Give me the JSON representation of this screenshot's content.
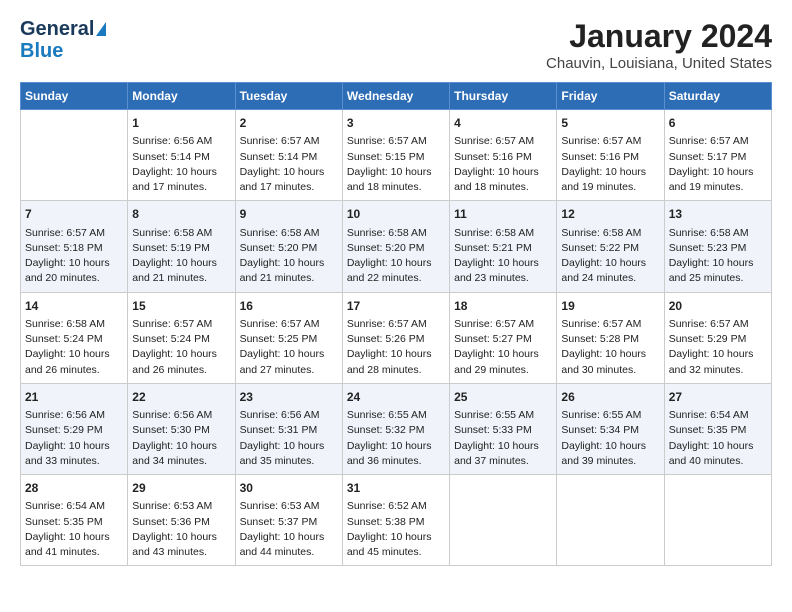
{
  "logo": {
    "line1": "General",
    "line2": "Blue"
  },
  "title": "January 2024",
  "subtitle": "Chauvin, Louisiana, United States",
  "days_of_week": [
    "Sunday",
    "Monday",
    "Tuesday",
    "Wednesday",
    "Thursday",
    "Friday",
    "Saturday"
  ],
  "weeks": [
    [
      {
        "num": "",
        "text": ""
      },
      {
        "num": "1",
        "text": "Sunrise: 6:56 AM\nSunset: 5:14 PM\nDaylight: 10 hours\nand 17 minutes."
      },
      {
        "num": "2",
        "text": "Sunrise: 6:57 AM\nSunset: 5:14 PM\nDaylight: 10 hours\nand 17 minutes."
      },
      {
        "num": "3",
        "text": "Sunrise: 6:57 AM\nSunset: 5:15 PM\nDaylight: 10 hours\nand 18 minutes."
      },
      {
        "num": "4",
        "text": "Sunrise: 6:57 AM\nSunset: 5:16 PM\nDaylight: 10 hours\nand 18 minutes."
      },
      {
        "num": "5",
        "text": "Sunrise: 6:57 AM\nSunset: 5:16 PM\nDaylight: 10 hours\nand 19 minutes."
      },
      {
        "num": "6",
        "text": "Sunrise: 6:57 AM\nSunset: 5:17 PM\nDaylight: 10 hours\nand 19 minutes."
      }
    ],
    [
      {
        "num": "7",
        "text": "Sunrise: 6:57 AM\nSunset: 5:18 PM\nDaylight: 10 hours\nand 20 minutes."
      },
      {
        "num": "8",
        "text": "Sunrise: 6:58 AM\nSunset: 5:19 PM\nDaylight: 10 hours\nand 21 minutes."
      },
      {
        "num": "9",
        "text": "Sunrise: 6:58 AM\nSunset: 5:20 PM\nDaylight: 10 hours\nand 21 minutes."
      },
      {
        "num": "10",
        "text": "Sunrise: 6:58 AM\nSunset: 5:20 PM\nDaylight: 10 hours\nand 22 minutes."
      },
      {
        "num": "11",
        "text": "Sunrise: 6:58 AM\nSunset: 5:21 PM\nDaylight: 10 hours\nand 23 minutes."
      },
      {
        "num": "12",
        "text": "Sunrise: 6:58 AM\nSunset: 5:22 PM\nDaylight: 10 hours\nand 24 minutes."
      },
      {
        "num": "13",
        "text": "Sunrise: 6:58 AM\nSunset: 5:23 PM\nDaylight: 10 hours\nand 25 minutes."
      }
    ],
    [
      {
        "num": "14",
        "text": "Sunrise: 6:58 AM\nSunset: 5:24 PM\nDaylight: 10 hours\nand 26 minutes."
      },
      {
        "num": "15",
        "text": "Sunrise: 6:57 AM\nSunset: 5:24 PM\nDaylight: 10 hours\nand 26 minutes."
      },
      {
        "num": "16",
        "text": "Sunrise: 6:57 AM\nSunset: 5:25 PM\nDaylight: 10 hours\nand 27 minutes."
      },
      {
        "num": "17",
        "text": "Sunrise: 6:57 AM\nSunset: 5:26 PM\nDaylight: 10 hours\nand 28 minutes."
      },
      {
        "num": "18",
        "text": "Sunrise: 6:57 AM\nSunset: 5:27 PM\nDaylight: 10 hours\nand 29 minutes."
      },
      {
        "num": "19",
        "text": "Sunrise: 6:57 AM\nSunset: 5:28 PM\nDaylight: 10 hours\nand 30 minutes."
      },
      {
        "num": "20",
        "text": "Sunrise: 6:57 AM\nSunset: 5:29 PM\nDaylight: 10 hours\nand 32 minutes."
      }
    ],
    [
      {
        "num": "21",
        "text": "Sunrise: 6:56 AM\nSunset: 5:29 PM\nDaylight: 10 hours\nand 33 minutes."
      },
      {
        "num": "22",
        "text": "Sunrise: 6:56 AM\nSunset: 5:30 PM\nDaylight: 10 hours\nand 34 minutes."
      },
      {
        "num": "23",
        "text": "Sunrise: 6:56 AM\nSunset: 5:31 PM\nDaylight: 10 hours\nand 35 minutes."
      },
      {
        "num": "24",
        "text": "Sunrise: 6:55 AM\nSunset: 5:32 PM\nDaylight: 10 hours\nand 36 minutes."
      },
      {
        "num": "25",
        "text": "Sunrise: 6:55 AM\nSunset: 5:33 PM\nDaylight: 10 hours\nand 37 minutes."
      },
      {
        "num": "26",
        "text": "Sunrise: 6:55 AM\nSunset: 5:34 PM\nDaylight: 10 hours\nand 39 minutes."
      },
      {
        "num": "27",
        "text": "Sunrise: 6:54 AM\nSunset: 5:35 PM\nDaylight: 10 hours\nand 40 minutes."
      }
    ],
    [
      {
        "num": "28",
        "text": "Sunrise: 6:54 AM\nSunset: 5:35 PM\nDaylight: 10 hours\nand 41 minutes."
      },
      {
        "num": "29",
        "text": "Sunrise: 6:53 AM\nSunset: 5:36 PM\nDaylight: 10 hours\nand 43 minutes."
      },
      {
        "num": "30",
        "text": "Sunrise: 6:53 AM\nSunset: 5:37 PM\nDaylight: 10 hours\nand 44 minutes."
      },
      {
        "num": "31",
        "text": "Sunrise: 6:52 AM\nSunset: 5:38 PM\nDaylight: 10 hours\nand 45 minutes."
      },
      {
        "num": "",
        "text": ""
      },
      {
        "num": "",
        "text": ""
      },
      {
        "num": "",
        "text": ""
      }
    ]
  ]
}
